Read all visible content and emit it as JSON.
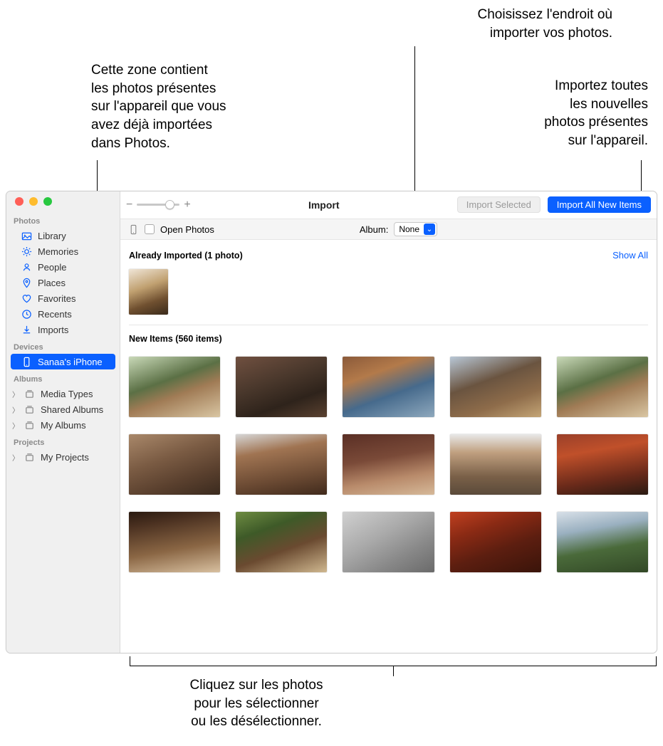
{
  "callouts": {
    "already_imported_zone": "Cette zone contient\nles photos présentes\nsur l'appareil que vous\navez déjà importées\ndans Photos.",
    "choose_location": "Choisissez l'endroit où\nimporter vos photos.",
    "import_all": "Importez toutes\nles nouvelles\nphotos présentes\nsur l'appareil.",
    "click_photos": "Cliquez sur les photos\npour les sélectionner\nou les désélectionner."
  },
  "sidebar": {
    "sections": {
      "photos_header": "Photos",
      "devices_header": "Devices",
      "albums_header": "Albums",
      "projects_header": "Projects"
    },
    "items": {
      "library": "Library",
      "memories": "Memories",
      "people": "People",
      "places": "Places",
      "favorites": "Favorites",
      "recents": "Recents",
      "imports": "Imports",
      "device": "Sanaa's iPhone",
      "media_types": "Media Types",
      "shared_albums": "Shared Albums",
      "my_albums": "My Albums",
      "my_projects": "My Projects"
    }
  },
  "toolbar": {
    "title": "Import",
    "import_selected": "Import Selected",
    "import_all": "Import All New Items"
  },
  "subbar": {
    "open_photos": "Open Photos",
    "album_label": "Album:",
    "album_value": "None"
  },
  "sections": {
    "already_imported": "Already Imported (1 photo)",
    "show_all": "Show All",
    "new_items": "New Items (560 items)"
  }
}
